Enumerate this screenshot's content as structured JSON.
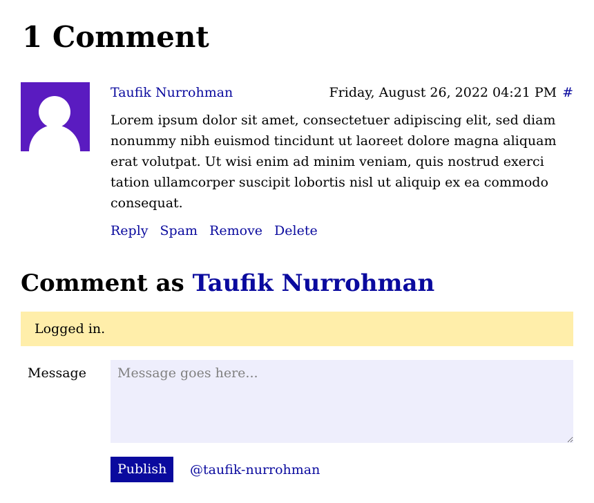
{
  "comments_section": {
    "heading": "1 Comment"
  },
  "comments": [
    {
      "author": "Taufik Nurrohman",
      "date": "Friday, August 26, 2022 04:21 PM",
      "permalink": "#",
      "text": "Lorem ipsum dolor sit amet, consectetuer adipiscing elit, sed diam nonummy nibh euismod tincidunt ut laoreet dolore magna aliquam erat volutpat. Ut wisi enim ad minim veniam, quis nostrud exerci tation ullamcorper suscipit lobortis nisl ut aliquip ex ea commodo consequat.",
      "actions": [
        "Reply",
        "Spam",
        "Remove",
        "Delete"
      ],
      "avatar_icon": "user-silhouette-icon"
    }
  ],
  "comment_form": {
    "heading_prefix": "Comment as",
    "user_name": "Taufik Nurrohman",
    "notice": "Logged in.",
    "message_label": "Message",
    "message_placeholder": "Message goes here...",
    "message_value": "",
    "publish_label": "Publish",
    "user_handle": "@taufik-nurrohman"
  },
  "colors": {
    "link": "#0a0a9e",
    "avatar_background": "#5a1bc0",
    "notice_background": "#ffeeaa",
    "input_background": "#eeeefc",
    "button_background": "#0a0a9e"
  }
}
